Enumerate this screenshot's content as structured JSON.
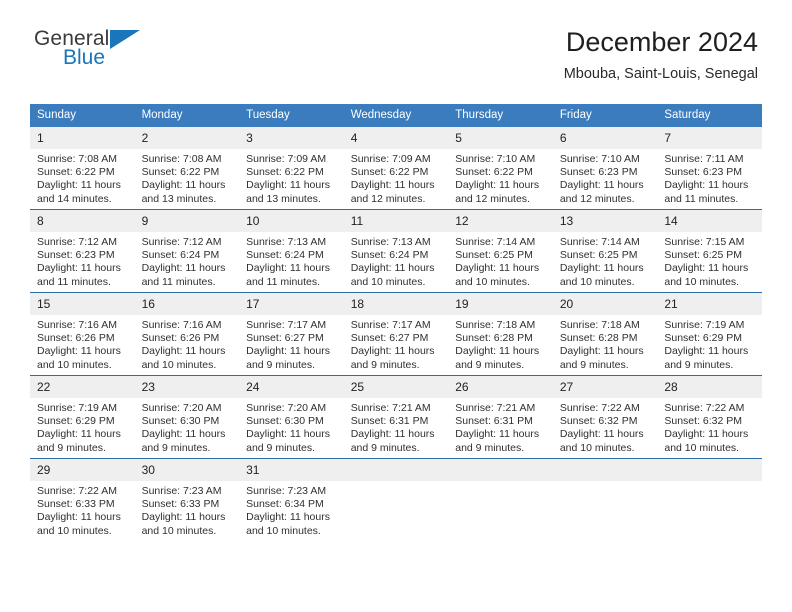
{
  "brand": {
    "name_part1": "General",
    "name_part2": "Blue",
    "logo_icon": "triangle-logo-icon",
    "color_primary": "#1b75bb",
    "color_text": "#3b3b3b"
  },
  "header": {
    "title": "December 2024",
    "subtitle": "Mbouba, Saint-Louis, Senegal"
  },
  "theme": {
    "header_bg": "#3a7cbe",
    "row_divider": "#2e6da8",
    "daynum_bg": "#efefef",
    "body_text": "#303030"
  },
  "calendar": {
    "weekday_headers": [
      "Sunday",
      "Monday",
      "Tuesday",
      "Wednesday",
      "Thursday",
      "Friday",
      "Saturday"
    ],
    "weeks": [
      [
        {
          "day": "1",
          "sunrise": "Sunrise: 7:08 AM",
          "sunset": "Sunset: 6:22 PM",
          "daylight_line1": "Daylight: 11 hours",
          "daylight_line2": "and 14 minutes."
        },
        {
          "day": "2",
          "sunrise": "Sunrise: 7:08 AM",
          "sunset": "Sunset: 6:22 PM",
          "daylight_line1": "Daylight: 11 hours",
          "daylight_line2": "and 13 minutes."
        },
        {
          "day": "3",
          "sunrise": "Sunrise: 7:09 AM",
          "sunset": "Sunset: 6:22 PM",
          "daylight_line1": "Daylight: 11 hours",
          "daylight_line2": "and 13 minutes."
        },
        {
          "day": "4",
          "sunrise": "Sunrise: 7:09 AM",
          "sunset": "Sunset: 6:22 PM",
          "daylight_line1": "Daylight: 11 hours",
          "daylight_line2": "and 12 minutes."
        },
        {
          "day": "5",
          "sunrise": "Sunrise: 7:10 AM",
          "sunset": "Sunset: 6:22 PM",
          "daylight_line1": "Daylight: 11 hours",
          "daylight_line2": "and 12 minutes."
        },
        {
          "day": "6",
          "sunrise": "Sunrise: 7:10 AM",
          "sunset": "Sunset: 6:23 PM",
          "daylight_line1": "Daylight: 11 hours",
          "daylight_line2": "and 12 minutes."
        },
        {
          "day": "7",
          "sunrise": "Sunrise: 7:11 AM",
          "sunset": "Sunset: 6:23 PM",
          "daylight_line1": "Daylight: 11 hours",
          "daylight_line2": "and 11 minutes."
        }
      ],
      [
        {
          "day": "8",
          "sunrise": "Sunrise: 7:12 AM",
          "sunset": "Sunset: 6:23 PM",
          "daylight_line1": "Daylight: 11 hours",
          "daylight_line2": "and 11 minutes."
        },
        {
          "day": "9",
          "sunrise": "Sunrise: 7:12 AM",
          "sunset": "Sunset: 6:24 PM",
          "daylight_line1": "Daylight: 11 hours",
          "daylight_line2": "and 11 minutes."
        },
        {
          "day": "10",
          "sunrise": "Sunrise: 7:13 AM",
          "sunset": "Sunset: 6:24 PM",
          "daylight_line1": "Daylight: 11 hours",
          "daylight_line2": "and 11 minutes."
        },
        {
          "day": "11",
          "sunrise": "Sunrise: 7:13 AM",
          "sunset": "Sunset: 6:24 PM",
          "daylight_line1": "Daylight: 11 hours",
          "daylight_line2": "and 10 minutes."
        },
        {
          "day": "12",
          "sunrise": "Sunrise: 7:14 AM",
          "sunset": "Sunset: 6:25 PM",
          "daylight_line1": "Daylight: 11 hours",
          "daylight_line2": "and 10 minutes."
        },
        {
          "day": "13",
          "sunrise": "Sunrise: 7:14 AM",
          "sunset": "Sunset: 6:25 PM",
          "daylight_line1": "Daylight: 11 hours",
          "daylight_line2": "and 10 minutes."
        },
        {
          "day": "14",
          "sunrise": "Sunrise: 7:15 AM",
          "sunset": "Sunset: 6:25 PM",
          "daylight_line1": "Daylight: 11 hours",
          "daylight_line2": "and 10 minutes."
        }
      ],
      [
        {
          "day": "15",
          "sunrise": "Sunrise: 7:16 AM",
          "sunset": "Sunset: 6:26 PM",
          "daylight_line1": "Daylight: 11 hours",
          "daylight_line2": "and 10 minutes."
        },
        {
          "day": "16",
          "sunrise": "Sunrise: 7:16 AM",
          "sunset": "Sunset: 6:26 PM",
          "daylight_line1": "Daylight: 11 hours",
          "daylight_line2": "and 10 minutes."
        },
        {
          "day": "17",
          "sunrise": "Sunrise: 7:17 AM",
          "sunset": "Sunset: 6:27 PM",
          "daylight_line1": "Daylight: 11 hours",
          "daylight_line2": "and 9 minutes."
        },
        {
          "day": "18",
          "sunrise": "Sunrise: 7:17 AM",
          "sunset": "Sunset: 6:27 PM",
          "daylight_line1": "Daylight: 11 hours",
          "daylight_line2": "and 9 minutes."
        },
        {
          "day": "19",
          "sunrise": "Sunrise: 7:18 AM",
          "sunset": "Sunset: 6:28 PM",
          "daylight_line1": "Daylight: 11 hours",
          "daylight_line2": "and 9 minutes."
        },
        {
          "day": "20",
          "sunrise": "Sunrise: 7:18 AM",
          "sunset": "Sunset: 6:28 PM",
          "daylight_line1": "Daylight: 11 hours",
          "daylight_line2": "and 9 minutes."
        },
        {
          "day": "21",
          "sunrise": "Sunrise: 7:19 AM",
          "sunset": "Sunset: 6:29 PM",
          "daylight_line1": "Daylight: 11 hours",
          "daylight_line2": "and 9 minutes."
        }
      ],
      [
        {
          "day": "22",
          "sunrise": "Sunrise: 7:19 AM",
          "sunset": "Sunset: 6:29 PM",
          "daylight_line1": "Daylight: 11 hours",
          "daylight_line2": "and 9 minutes."
        },
        {
          "day": "23",
          "sunrise": "Sunrise: 7:20 AM",
          "sunset": "Sunset: 6:30 PM",
          "daylight_line1": "Daylight: 11 hours",
          "daylight_line2": "and 9 minutes."
        },
        {
          "day": "24",
          "sunrise": "Sunrise: 7:20 AM",
          "sunset": "Sunset: 6:30 PM",
          "daylight_line1": "Daylight: 11 hours",
          "daylight_line2": "and 9 minutes."
        },
        {
          "day": "25",
          "sunrise": "Sunrise: 7:21 AM",
          "sunset": "Sunset: 6:31 PM",
          "daylight_line1": "Daylight: 11 hours",
          "daylight_line2": "and 9 minutes."
        },
        {
          "day": "26",
          "sunrise": "Sunrise: 7:21 AM",
          "sunset": "Sunset: 6:31 PM",
          "daylight_line1": "Daylight: 11 hours",
          "daylight_line2": "and 9 minutes."
        },
        {
          "day": "27",
          "sunrise": "Sunrise: 7:22 AM",
          "sunset": "Sunset: 6:32 PM",
          "daylight_line1": "Daylight: 11 hours",
          "daylight_line2": "and 10 minutes."
        },
        {
          "day": "28",
          "sunrise": "Sunrise: 7:22 AM",
          "sunset": "Sunset: 6:32 PM",
          "daylight_line1": "Daylight: 11 hours",
          "daylight_line2": "and 10 minutes."
        }
      ],
      [
        {
          "day": "29",
          "sunrise": "Sunrise: 7:22 AM",
          "sunset": "Sunset: 6:33 PM",
          "daylight_line1": "Daylight: 11 hours",
          "daylight_line2": "and 10 minutes."
        },
        {
          "day": "30",
          "sunrise": "Sunrise: 7:23 AM",
          "sunset": "Sunset: 6:33 PM",
          "daylight_line1": "Daylight: 11 hours",
          "daylight_line2": "and 10 minutes."
        },
        {
          "day": "31",
          "sunrise": "Sunrise: 7:23 AM",
          "sunset": "Sunset: 6:34 PM",
          "daylight_line1": "Daylight: 11 hours",
          "daylight_line2": "and 10 minutes."
        },
        {
          "day": "",
          "sunrise": "",
          "sunset": "",
          "daylight_line1": "",
          "daylight_line2": ""
        },
        {
          "day": "",
          "sunrise": "",
          "sunset": "",
          "daylight_line1": "",
          "daylight_line2": ""
        },
        {
          "day": "",
          "sunrise": "",
          "sunset": "",
          "daylight_line1": "",
          "daylight_line2": ""
        },
        {
          "day": "",
          "sunrise": "",
          "sunset": "",
          "daylight_line1": "",
          "daylight_line2": ""
        }
      ]
    ]
  }
}
